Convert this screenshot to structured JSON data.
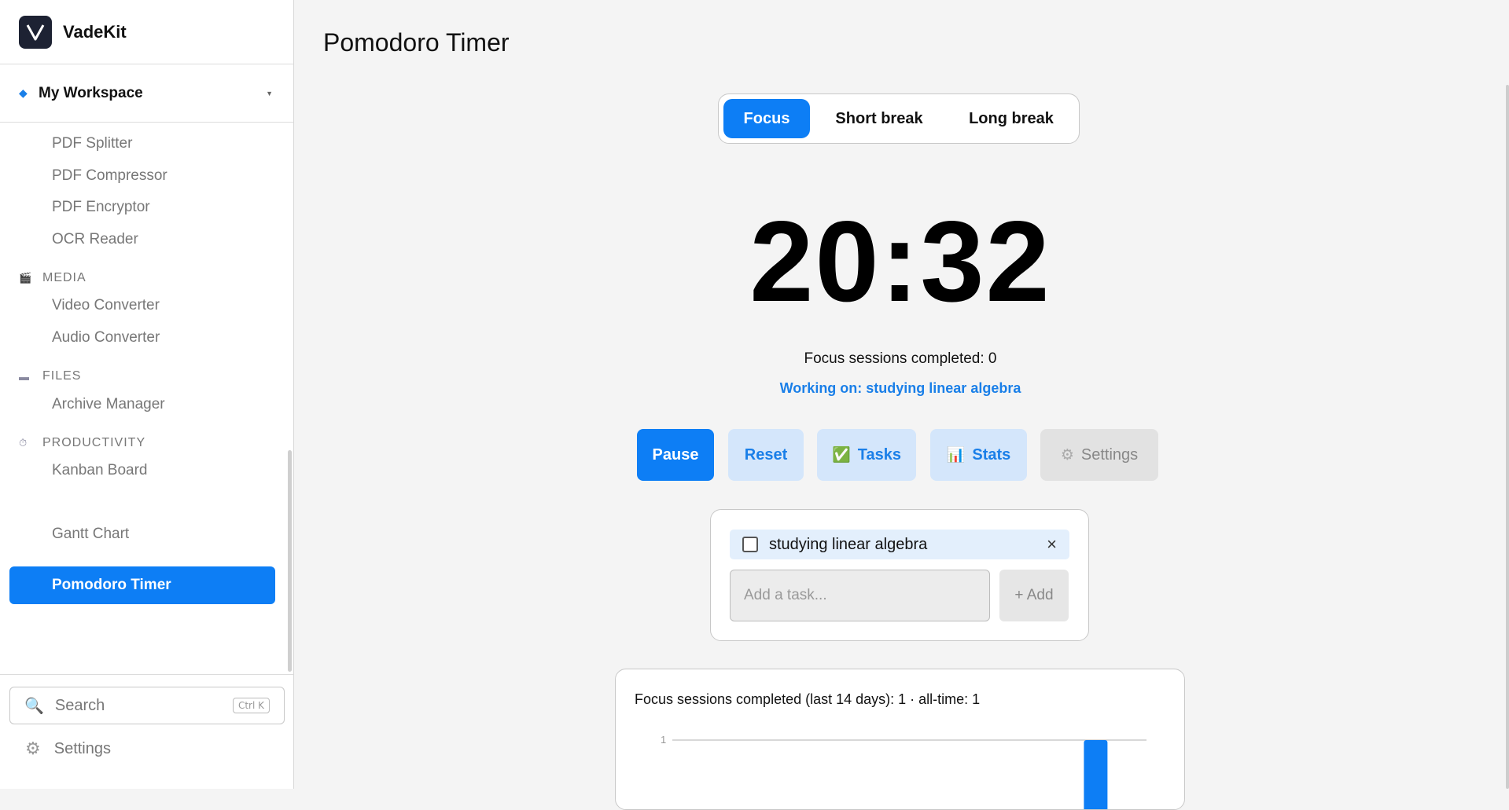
{
  "brand": {
    "name": "VadeKit",
    "logo_letter": "V"
  },
  "workspace": {
    "name": "My Workspace"
  },
  "sidebar": {
    "items_top": [
      "PDF Splitter",
      "PDF Compressor",
      "PDF Encryptor",
      "OCR Reader"
    ],
    "sections": [
      {
        "label": "MEDIA",
        "icon": "clapperboard-icon",
        "items": [
          "Video Converter",
          "Audio Converter"
        ]
      },
      {
        "label": "FILES",
        "icon": "folder-icon",
        "items": [
          "Archive Manager"
        ]
      },
      {
        "label": "PRODUCTIVITY",
        "icon": "stopwatch-icon",
        "items": [
          "Kanban Board",
          "Pomodoro Timer",
          "Gantt Chart"
        ]
      }
    ],
    "active_item": "Pomodoro Timer",
    "search": {
      "placeholder": "Search",
      "shortcut": "Ctrl K"
    },
    "settings_label": "Settings"
  },
  "page": {
    "title": "Pomodoro Timer"
  },
  "timer": {
    "modes": [
      "Focus",
      "Short break",
      "Long break"
    ],
    "active_mode": "Focus",
    "display": "20:32",
    "sessions_text": "Focus sessions completed: 0",
    "working_on": "Working on: studying linear algebra"
  },
  "actions": {
    "pause": "Pause",
    "reset": "Reset",
    "tasks": "Tasks",
    "stats": "Stats",
    "settings": "Settings"
  },
  "tasks": {
    "items": [
      {
        "text": "studying linear algebra",
        "done": false
      }
    ],
    "input_placeholder": "Add a task...",
    "add_label": "+ Add"
  },
  "stats": {
    "title": "Focus sessions completed (last 14 days): 1 · all-time: 1"
  },
  "chart_data": {
    "type": "bar",
    "title": "Focus sessions completed (last 14 days): 1 · all-time: 1",
    "yticks": [
      1
    ],
    "ylim": [
      0,
      1
    ],
    "values": [
      0,
      0,
      0,
      0,
      0,
      0,
      0,
      0,
      0,
      0,
      0,
      0,
      1,
      0
    ],
    "bar_color": "#0d7ef5"
  },
  "colors": {
    "accent": "#0d7ef5",
    "accent_soft": "#d4e6fb"
  }
}
